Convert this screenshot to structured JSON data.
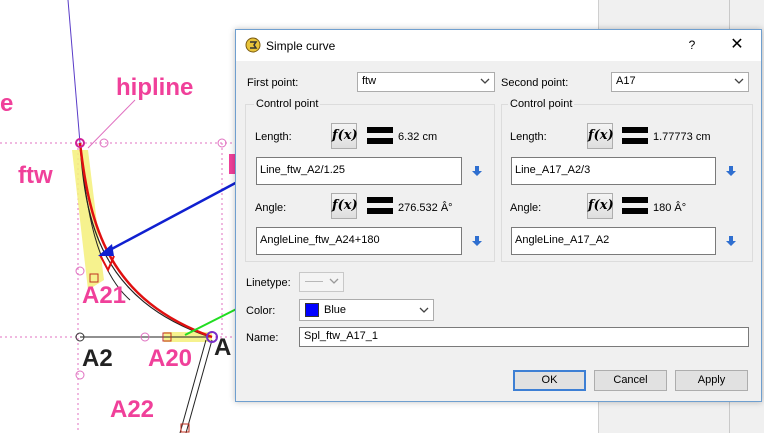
{
  "canvas": {
    "labels": {
      "e": "e",
      "hipline": "hipline",
      "ftw": "ftw",
      "a21": "A21",
      "a2": "A2",
      "a20": "A20",
      "a22": "A22",
      "a_partial": "A"
    },
    "colors": {
      "pink": "#f0409a",
      "red": "#e01010",
      "blue": "#1020d0",
      "green": "#22dd22",
      "highlight": "#f5f07a"
    }
  },
  "dialog": {
    "title": "Simple curve",
    "help_label": "?",
    "close_label": "✕",
    "first_point_label": "First point:",
    "first_point_value": "ftw",
    "second_point_label": "Second point:",
    "second_point_value": "A17",
    "control_point_left": {
      "group_title": "Control point",
      "length_label": "Length:",
      "length_value": "6.32 cm",
      "length_formula": "Line_ftw_A2/1.25",
      "angle_label": "Angle:",
      "angle_value": "276.532 Â°",
      "angle_formula": "AngleLine_ftw_A24+180"
    },
    "control_point_right": {
      "group_title": "Control point",
      "length_label": "Length:",
      "length_value": "1.77773 cm",
      "length_formula": "Line_A17_A2/3",
      "angle_label": "Angle:",
      "angle_value": "180 Â°",
      "angle_formula": "AngleLine_A17_A2"
    },
    "fx_label": "f(x)",
    "linetype_label": "Linetype:",
    "color_label": "Color:",
    "color_value": "Blue",
    "color_swatch": "#0000ff",
    "name_label": "Name:",
    "name_value": "Spl_ftw_A17_1",
    "ok_label": "OK",
    "cancel_label": "Cancel",
    "apply_label": "Apply"
  }
}
